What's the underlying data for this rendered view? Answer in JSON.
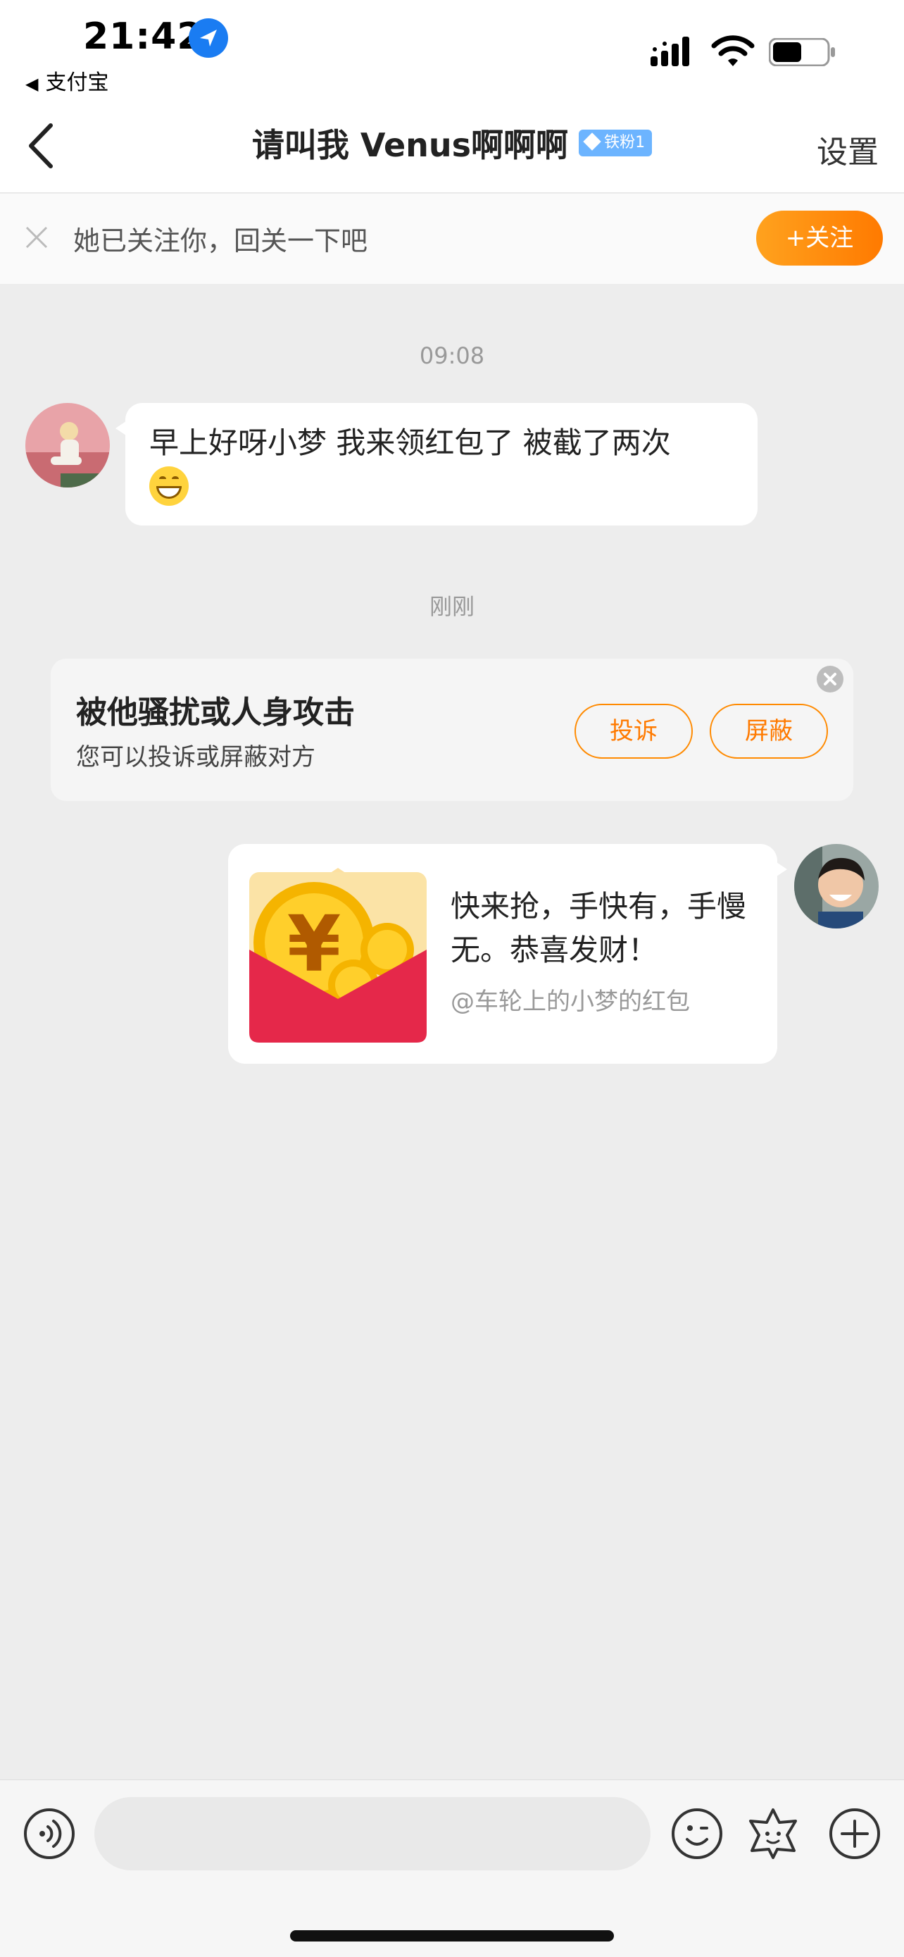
{
  "status_bar": {
    "time": "21:42",
    "back_app": "支付宝"
  },
  "nav": {
    "title": "请叫我 Venus啊啊啊",
    "fan_badge": "铁粉1",
    "settings_label": "设置"
  },
  "follow_strip": {
    "text": "她已关注你，回关一下吧",
    "button_label": "+关注"
  },
  "messages": [
    {
      "timestamp": "09:08",
      "text": "早上好呀小梦 我来领红包了 被截了两次"
    }
  ],
  "second_timestamp": "刚刚",
  "report_card": {
    "title": "被他骚扰或人身攻击",
    "subtitle": "您可以投诉或屏蔽对方",
    "complain_label": "投诉",
    "block_label": "屏蔽"
  },
  "red_packet": {
    "message": "快来抢，手快有，手慢无。恭喜发财！",
    "from": "@车轮上的小梦的红包"
  },
  "input": {
    "placeholder": ""
  },
  "colors": {
    "accent_orange": "#ff7a00",
    "background": "#ededed",
    "red_packet": "#e5284a"
  },
  "icons": [
    "back-arrow-icon",
    "close-icon",
    "voice-icon",
    "emoji-icon",
    "sticker-icon",
    "plus-icon",
    "location-arrow-icon",
    "signal-icon",
    "wifi-icon",
    "battery-icon"
  ]
}
